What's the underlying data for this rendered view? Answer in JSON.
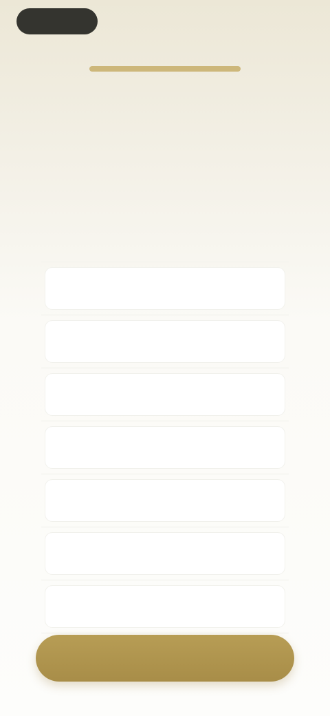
{
  "header": {
    "back_label": "",
    "skip_label": "",
    "progress_fraction": 1.0
  },
  "question": {
    "title": "",
    "subtitle": ""
  },
  "options": [
    {
      "label": ""
    },
    {
      "label": ""
    },
    {
      "label": ""
    },
    {
      "label": ""
    },
    {
      "label": ""
    },
    {
      "label": ""
    },
    {
      "label": ""
    }
  ],
  "footer": {
    "continue_label": ""
  },
  "colors": {
    "accent": "#b79d55",
    "progress_track": "#e6d9b4",
    "pill_dark": "#34342f"
  }
}
